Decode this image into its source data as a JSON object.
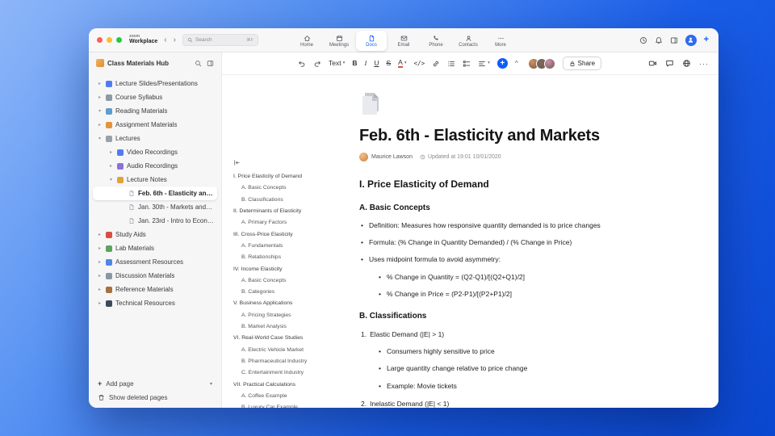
{
  "colors": {
    "accent": "#0b5cff"
  },
  "titlebar": {
    "logo_top": "zoom",
    "logo_bottom": "Workplace",
    "search_placeholder": "Search",
    "search_shortcut": "⌘F",
    "nav": [
      {
        "label": "Home",
        "icon": "home"
      },
      {
        "label": "Meetings",
        "icon": "calendar"
      },
      {
        "label": "Docs",
        "icon": "docs",
        "active": true
      },
      {
        "label": "Email",
        "icon": "mail"
      },
      {
        "label": "Phone",
        "icon": "phone"
      },
      {
        "label": "Contacts",
        "icon": "contacts"
      },
      {
        "label": "More",
        "icon": "dots"
      }
    ],
    "actions": [
      {
        "name": "history-button",
        "icon": "clock"
      },
      {
        "name": "notifications-button",
        "icon": "bell"
      },
      {
        "name": "layout-panel-button",
        "icon": "panel"
      },
      {
        "name": "profile-avatar",
        "icon": "user",
        "avatar": true
      },
      {
        "name": "new-button",
        "label": "+",
        "plus": true
      }
    ]
  },
  "sidebar": {
    "title": "Class Materials Hub",
    "add_page": "Add page",
    "show_deleted": "Show deleted pages",
    "items": [
      {
        "label": "Lecture Slides/Presentations",
        "level": 0,
        "chevron": "right",
        "icon": "slides-icon",
        "color": "#4f7df0"
      },
      {
        "label": "Course Syllabus",
        "level": 0,
        "chevron": "right",
        "icon": "syllabus-icon",
        "color": "#8f98a3"
      },
      {
        "label": "Reading Materials",
        "level": 0,
        "chevron": "down",
        "icon": "reading-icon",
        "color": "#5f9ccf"
      },
      {
        "label": "Assignment Materials",
        "level": 0,
        "chevron": "right",
        "icon": "assignment-icon",
        "color": "#e6923c"
      },
      {
        "label": "Lectures",
        "level": 0,
        "chevron": "down",
        "icon": "lectures-icon",
        "color": "#98a0ab"
      },
      {
        "label": "Video Recordings",
        "level": 1,
        "chevron": "right",
        "icon": "video-icon",
        "color": "#4f7df0"
      },
      {
        "label": "Audio Recordings",
        "level": 1,
        "chevron": "right",
        "icon": "audio-icon",
        "color": "#8f6fd8"
      },
      {
        "label": "Lecture Notes",
        "level": 1,
        "chevron": "down",
        "icon": "notes-icon",
        "color": "#e0a33c"
      },
      {
        "label": "Feb. 6th - Elasticity and M...",
        "level": 2,
        "chevron": "none",
        "icon": "page-icon",
        "page": true,
        "selected": true
      },
      {
        "label": "Jan. 30th - Markets and P...",
        "level": 2,
        "chevron": "none",
        "icon": "page-icon",
        "page": true
      },
      {
        "label": "Jan. 23rd - Intro to Econo...",
        "level": 2,
        "chevron": "none",
        "icon": "page-icon",
        "page": true
      },
      {
        "label": "Study Aids",
        "level": 0,
        "chevron": "right",
        "icon": "study-icon",
        "color": "#d94f3f"
      },
      {
        "label": "Lab Materials",
        "level": 0,
        "chevron": "right",
        "icon": "lab-icon",
        "color": "#57a65a"
      },
      {
        "label": "Assessment Resources",
        "level": 0,
        "chevron": "right",
        "icon": "assessment-icon",
        "color": "#4f86e8"
      },
      {
        "label": "Discussion Materials",
        "level": 0,
        "chevron": "right",
        "icon": "discussion-icon",
        "color": "#8c97a5"
      },
      {
        "label": "Reference Materials",
        "level": 0,
        "chevron": "right",
        "icon": "reference-icon",
        "color": "#a6703f"
      },
      {
        "label": "Technical Resources",
        "level": 0,
        "chevron": "right",
        "icon": "technical-icon",
        "color": "#3d4a5c"
      }
    ]
  },
  "toolbar": {
    "share_label": "Share",
    "items": [
      {
        "name": "undo-button",
        "icon": "undo"
      },
      {
        "name": "redo-button",
        "icon": "redo"
      },
      {
        "name": "text-style-dropdown",
        "label": "Text",
        "caret": true
      },
      {
        "name": "bold-button",
        "label": "B",
        "cls": "tb-bold"
      },
      {
        "name": "italic-button",
        "label": "I",
        "cls": "tb-italic"
      },
      {
        "name": "underline-button",
        "label": "U",
        "cls": "tb-underline"
      },
      {
        "name": "strikethrough-button",
        "label": "S",
        "cls": "tb-strike"
      },
      {
        "name": "text-color-button",
        "label": "A",
        "cls": "tb-colorA",
        "caret": true
      },
      {
        "name": "code-button",
        "label": "</>",
        "cls": "tb-mono"
      },
      {
        "name": "link-button",
        "icon": "link"
      },
      {
        "name": "bulleted-list-button",
        "icon": "list"
      },
      {
        "name": "checklist-button",
        "icon": "checklist"
      },
      {
        "name": "align-button",
        "icon": "align",
        "caret": true
      },
      {
        "name": "insert-button",
        "label": "+",
        "cls": "tb-insert"
      },
      {
        "name": "collapse-toolbar-button",
        "label": "^",
        "cls": "tb-caretup"
      }
    ],
    "avatars": [
      "#d58f5a",
      "#7a6a5f",
      "#cf8fae"
    ],
    "right_items": [
      {
        "name": "record-button",
        "icon": "camera"
      },
      {
        "name": "comment-button",
        "icon": "comment"
      },
      {
        "name": "language-button",
        "icon": "globe"
      },
      {
        "name": "more-options-button",
        "label": "···"
      }
    ]
  },
  "document": {
    "title": "Feb. 6th - Elasticity and Markets",
    "author": "Maurice Lawson",
    "updated": "Updated at 19:01 10/01/2020",
    "outline": [
      {
        "text": "I. Price Elasticity of Demand",
        "level": 0
      },
      {
        "text": "A. Basic Concepts",
        "level": 1
      },
      {
        "text": "B. Classifications",
        "level": 1
      },
      {
        "text": "II. Determinants of Elasticity",
        "level": 0
      },
      {
        "text": "A. Primary Factors",
        "level": 1
      },
      {
        "text": "III. Cross-Price Elasticity",
        "level": 0
      },
      {
        "text": "A. Fundamentals",
        "level": 1
      },
      {
        "text": "B. Relationships",
        "level": 1
      },
      {
        "text": "IV. Income Elasticity",
        "level": 0
      },
      {
        "text": "A. Basic Concepts",
        "level": 1
      },
      {
        "text": "B. Categories",
        "level": 1
      },
      {
        "text": "V. Business Applications",
        "level": 0
      },
      {
        "text": "A. Pricing Strategies",
        "level": 1
      },
      {
        "text": "B. Market Analysis",
        "level": 1
      },
      {
        "text": "VI. Real-World Case Studies",
        "level": 0
      },
      {
        "text": "A. Electric Vehicle Market",
        "level": 1
      },
      {
        "text": "B. Pharmaceutical Industry",
        "level": 1
      },
      {
        "text": "C. Entertainment Industry",
        "level": 1
      },
      {
        "text": "VII. Practical Calculations",
        "level": 0
      },
      {
        "text": "A. Coffee Example",
        "level": 1
      },
      {
        "text": "B. Luxury Car Example",
        "level": 1
      }
    ],
    "blocks": [
      {
        "type": "h2",
        "text": "I. Price Elasticity of Demand"
      },
      {
        "type": "h3",
        "text": "A. Basic Concepts"
      },
      {
        "type": "bullet",
        "level": 0,
        "text": "Definition: Measures how responsive quantity demanded is to price changes"
      },
      {
        "type": "bullet",
        "level": 0,
        "text": "Formula: (% Change in Quantity Demanded) / (% Change in Price)"
      },
      {
        "type": "bullet",
        "level": 0,
        "text": "Uses midpoint formula to avoid asymmetry:"
      },
      {
        "type": "bullet",
        "level": 1,
        "text": "% Change in Quantity = (Q2-Q1)/[(Q2+Q1)/2]"
      },
      {
        "type": "bullet",
        "level": 1,
        "text": "% Change in Price = (P2-P1)/[(P2+P1)/2]"
      },
      {
        "type": "h3",
        "text": "B. Classifications"
      },
      {
        "type": "number",
        "num": "1.",
        "text": "Elastic Demand (|E| > 1)"
      },
      {
        "type": "bullet",
        "level": 1,
        "text": "Consumers highly sensitive to price"
      },
      {
        "type": "bullet",
        "level": 1,
        "text": "Large quantity change relative to price change"
      },
      {
        "type": "bullet",
        "level": 1,
        "text": "Example: Movie tickets"
      },
      {
        "type": "number",
        "num": "2.",
        "text": "Inelastic Demand (|E| < 1)"
      }
    ]
  }
}
